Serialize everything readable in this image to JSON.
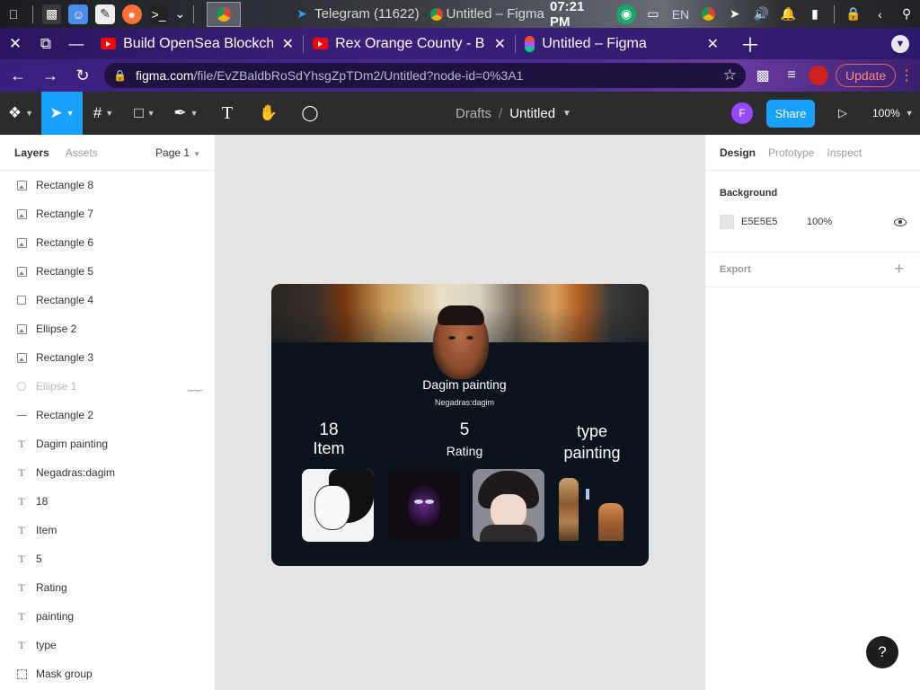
{
  "taskbar": {
    "telegram_title": "Telegram (11622)",
    "chrome_title": "Untitled – Figma ...",
    "clock": "07:21 PM",
    "lang": "EN"
  },
  "tabs": [
    {
      "label": "Build OpenSea Blockchain",
      "favicon": "youtube-icon"
    },
    {
      "label": "Rex Orange County - Best",
      "favicon": "youtube-icon"
    },
    {
      "label": "Untitled – Figma",
      "favicon": "figma-icon"
    }
  ],
  "address": {
    "host": "figma.com",
    "path": "/file/EvZBaldbRoSdYhsgZpTDm2/Untitled?node-id=0%3A1"
  },
  "browser": {
    "update_label": "Update"
  },
  "figma_toolbar": {
    "breadcrumb_parent": "Drafts",
    "file_name": "Untitled",
    "avatar_initial": "F",
    "share_label": "Share",
    "zoom": "100%"
  },
  "left_panel": {
    "tab_layers": "Layers",
    "tab_assets": "Assets",
    "page": "Page 1",
    "layers": [
      {
        "name": "Rectangle 8",
        "icon": "image-icon"
      },
      {
        "name": "Rectangle 7",
        "icon": "image-icon"
      },
      {
        "name": "Rectangle 6",
        "icon": "image-icon"
      },
      {
        "name": "Rectangle 5",
        "icon": "image-icon"
      },
      {
        "name": "Rectangle 4",
        "icon": "rectangle-icon"
      },
      {
        "name": "Ellipse 2",
        "icon": "image-icon"
      },
      {
        "name": "Rectangle 3",
        "icon": "image-icon"
      },
      {
        "name": "Ellipse 1",
        "icon": "ellipse-icon",
        "hidden": true
      },
      {
        "name": "Rectangle 2",
        "icon": "line-icon"
      },
      {
        "name": "Dagim painting",
        "icon": "text-icon"
      },
      {
        "name": "Negadras:dagim",
        "icon": "text-icon"
      },
      {
        "name": "18",
        "icon": "text-icon"
      },
      {
        "name": "Item",
        "icon": "text-icon"
      },
      {
        "name": "5",
        "icon": "text-icon"
      },
      {
        "name": "Rating",
        "icon": "text-icon"
      },
      {
        "name": "painting",
        "icon": "text-icon"
      },
      {
        "name": "type",
        "icon": "text-icon"
      },
      {
        "name": "Mask group",
        "icon": "mask-icon"
      }
    ]
  },
  "card": {
    "title": "Dagim painting",
    "subtitle": "Negadras:dagim",
    "items_count": "18",
    "items_label": "Item",
    "rating_value": "5",
    "rating_label": "Rating",
    "type_label": "type",
    "type_value": "painting"
  },
  "right_panel": {
    "tab_design": "Design",
    "tab_prototype": "Prototype",
    "tab_inspect": "Inspect",
    "background_title": "Background",
    "background_hex": "E5E5E5",
    "background_opacity": "100%",
    "export_label": "Export"
  },
  "colors": {
    "figma_blue": "#18a0fb",
    "toolbar_bg": "#2c2c2c",
    "canvas_bg": "#e5e5e5",
    "card_bg": "#0b141d",
    "avatar_purple": "#9747ff"
  }
}
